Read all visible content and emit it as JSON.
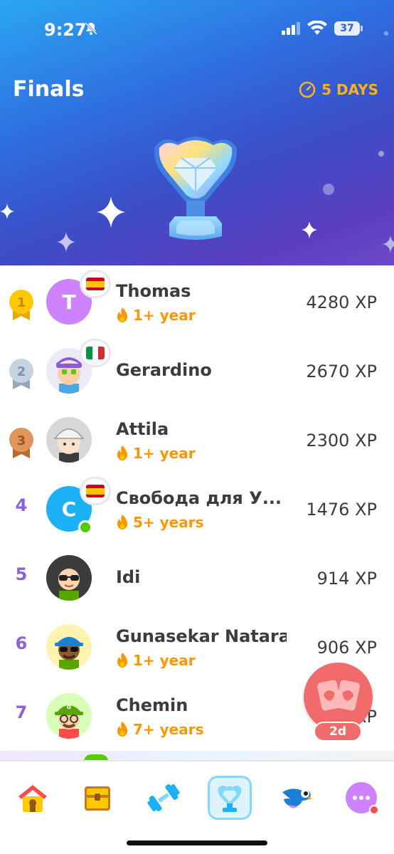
{
  "status_bar": {
    "time": "9:27",
    "battery": "37"
  },
  "league": {
    "title": "Finals",
    "time_left": "5 DAYS"
  },
  "leaderboard": [
    {
      "rank": "1",
      "name": "Thomas",
      "streak": "1+ year",
      "xp": "4280 XP",
      "avatar_letter": "T",
      "flag": "spain"
    },
    {
      "rank": "2",
      "name": "Gerardino",
      "streak": "",
      "xp": "2670 XP",
      "flag": "italy"
    },
    {
      "rank": "3",
      "name": "Attila",
      "streak": "1+ year",
      "xp": "2300 XP"
    },
    {
      "rank": "4",
      "name": "Свобода для У...",
      "streak": "5+ years",
      "xp": "1476 XP",
      "avatar_letter": "C",
      "flag": "spain",
      "online": true
    },
    {
      "rank": "5",
      "name": "Idi",
      "streak": "",
      "xp": "914 XP"
    },
    {
      "rank": "6",
      "name": "Gunasekar Nataraj",
      "streak": "1+ year",
      "xp": "906 XP"
    },
    {
      "rank": "7",
      "name": "Chemin",
      "streak": "7+ years",
      "xp": "XP"
    }
  ],
  "fab": {
    "badge": "2d"
  },
  "tabs": [
    {
      "icon": "home-icon",
      "active": false
    },
    {
      "icon": "chest-icon",
      "active": false
    },
    {
      "icon": "dumbbell-icon",
      "active": false
    },
    {
      "icon": "trophy-icon",
      "active": true
    },
    {
      "icon": "bird-icon",
      "active": false
    },
    {
      "icon": "more-icon",
      "active": false
    }
  ],
  "colors": {
    "streak": "#ff9600",
    "rank_purple": "#8c62d8",
    "gold": "#ffc800",
    "silver": "#b6c4d2",
    "bronze": "#d6884c",
    "fab": "#f26b6b",
    "online": "#58cc02"
  }
}
